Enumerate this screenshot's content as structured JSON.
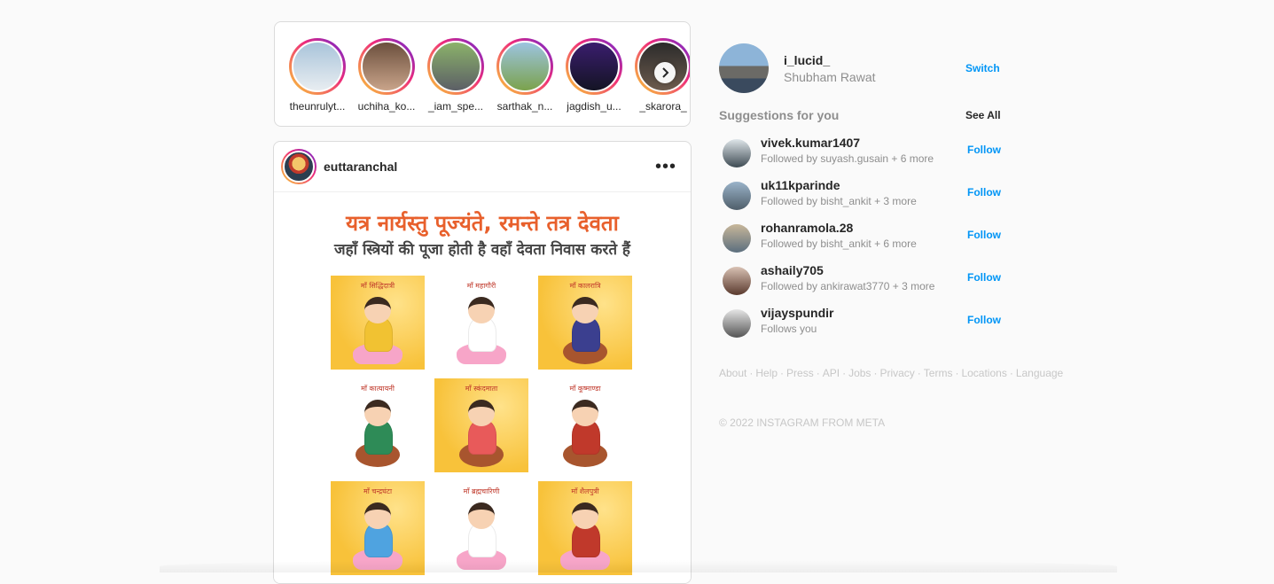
{
  "stories": [
    {
      "name": "theunrulyt...",
      "colors": [
        "#a9c4da",
        "#e8edf1"
      ]
    },
    {
      "name": "uchiha_ko...",
      "colors": [
        "#6b4f3d",
        "#c9a48a"
      ]
    },
    {
      "name": "_iam_spe...",
      "colors": [
        "#8bb26a",
        "#5c5f66"
      ]
    },
    {
      "name": "sarthak_n...",
      "colors": [
        "#9cc4e0",
        "#7ba24c"
      ]
    },
    {
      "name": "jagdish_u...",
      "colors": [
        "#3a1d6e",
        "#141424"
      ]
    },
    {
      "name": "_skarora_",
      "colors": [
        "#2b2b2b",
        "#6d5b4d"
      ]
    }
  ],
  "stories_next_icon": "chevron-right-icon",
  "post": {
    "username": "euttaranchal",
    "more_icon": "ellipsis-icon",
    "hindi_title": "यत्र नार्यस्तु पूज्यंते, रमन्ते तत्र देवता",
    "hindi_subtitle": "जहाँ स्त्रियों की पूजा होती है वहाँ देवता निवास करते हैं",
    "tiles": [
      {
        "caption": "माँ सिद्धिदात्री",
        "bg": "yellow",
        "dress": "#f1c232",
        "base": "lotus"
      },
      {
        "caption": "माँ महागौरी",
        "bg": "white",
        "dress": "#ffffff",
        "base": "lotus"
      },
      {
        "caption": "माँ कालरात्रि",
        "bg": "yellow",
        "dress": "#3b3f8f",
        "base": "lion"
      },
      {
        "caption": "माँ कात्यायनी",
        "bg": "white",
        "dress": "#2e8b57",
        "base": "lion"
      },
      {
        "caption": "माँ स्कंदमाता",
        "bg": "yellow",
        "dress": "#e85a5a",
        "base": "lion"
      },
      {
        "caption": "माँ कूष्माण्डा",
        "bg": "white",
        "dress": "#c0392b",
        "base": "lion"
      },
      {
        "caption": "माँ चन्द्रघंटा",
        "bg": "yellow",
        "dress": "#4fa3e0",
        "base": "lotus"
      },
      {
        "caption": "माँ ब्रह्मचारिणी",
        "bg": "white",
        "dress": "#ffffff",
        "base": "lotus"
      },
      {
        "caption": "माँ शैलपुत्री",
        "bg": "yellow",
        "dress": "#c0392b",
        "base": "lotus"
      }
    ]
  },
  "profile": {
    "username": "i_lucid_",
    "full_name": "Shubham Rawat",
    "switch_label": "Switch"
  },
  "suggestions_title": "Suggestions for you",
  "see_all_label": "See All",
  "suggestions": [
    {
      "username": "vivek.kumar1407",
      "subtitle": "Followed by suyash.gusain + 6 more",
      "action": "Follow",
      "colors": [
        "#dfe6ea",
        "#3e4b53"
      ]
    },
    {
      "username": "uk11kparinde",
      "subtitle": "Followed by bisht_ankit + 3 more",
      "action": "Follow",
      "colors": [
        "#9ab3c9",
        "#4f5e6a"
      ]
    },
    {
      "username": "rohanramola.28",
      "subtitle": "Followed by bisht_ankit + 6 more",
      "action": "Follow",
      "colors": [
        "#c8b79a",
        "#5b6e7e"
      ]
    },
    {
      "username": "ashaily705",
      "subtitle": "Followed by ankirawat3770 + 3 more",
      "action": "Follow",
      "colors": [
        "#d9c2b4",
        "#5a3a2e"
      ]
    },
    {
      "username": "vijayspundir",
      "subtitle": "Follows you",
      "action": "Follow",
      "colors": [
        "#e6e6e6",
        "#555555"
      ]
    }
  ],
  "footer_links": [
    "About",
    "Help",
    "Press",
    "API",
    "Jobs",
    "Privacy",
    "Terms",
    "Locations",
    "Language"
  ],
  "copyright": "© 2022 INSTAGRAM FROM META",
  "colors": {
    "accent": "#0095f6",
    "muted": "#8e8e8e",
    "ring_gradient": [
      "#f9ce34",
      "#ee2a7b",
      "#6228d7"
    ]
  }
}
